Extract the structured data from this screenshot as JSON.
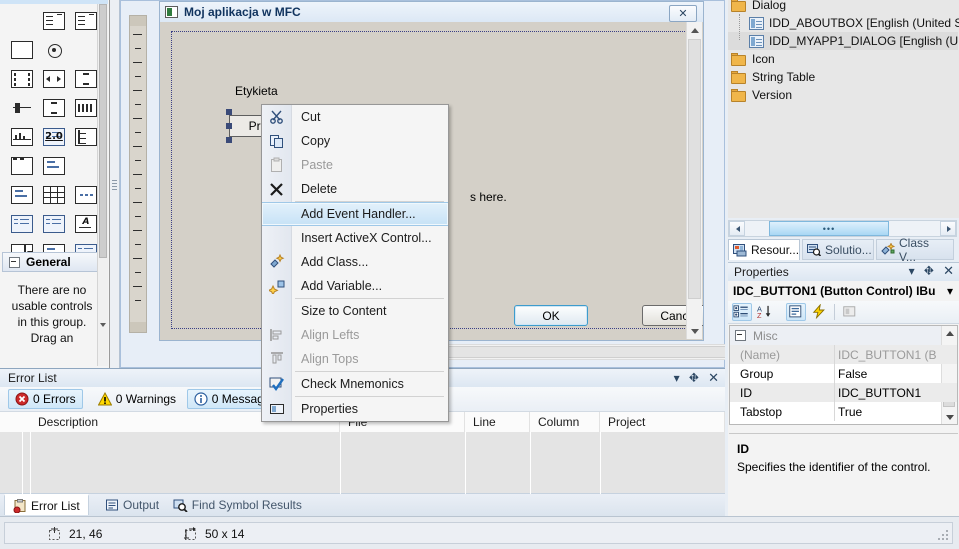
{
  "toolbox": {
    "group_label": "General",
    "empty_text": "There are no usable controls in this group. Drag an",
    "icons": [
      "textbox-icon",
      "listbox-icon",
      "listcontrol-icon",
      "groupbox-icon",
      "radio-button-icon",
      "static-text-icon",
      "animation-icon",
      "splitbutton-icon",
      "spin-control-icon",
      "slider-icon",
      "scrollbar-icon",
      "progress-icon",
      "hotkey-icon",
      "listview-icon",
      "treecontrol-icon",
      "picture-icon",
      "mfc-control-icon",
      "link-control-icon",
      "syslink-icon",
      "grid-control-icon",
      "ellipsis-icon",
      "tab-control-icon",
      "custom-control-icon",
      "rich-edit-icon",
      "combobox-icon",
      "network-icon",
      "caption-icon"
    ]
  },
  "designer": {
    "dialog_title": "Moj aplikacja w MFC",
    "close_button": "✕",
    "label_etykieta": "Etykieta",
    "button_przycisk": "Przycisk",
    "radio_dot": "∘",
    "static_here": "s here.",
    "ok_label": "OK",
    "cancel_label": "Cancel"
  },
  "context_menu": {
    "items": [
      {
        "label": "Cut",
        "icon": "scissors-icon",
        "enabled": true,
        "selected": false,
        "sep_after": false
      },
      {
        "label": "Copy",
        "icon": "copy-icon",
        "enabled": true,
        "selected": false,
        "sep_after": false
      },
      {
        "label": "Paste",
        "icon": "paste-icon",
        "enabled": false,
        "selected": false,
        "sep_after": false
      },
      {
        "label": "Delete",
        "icon": "delete-x-icon",
        "enabled": true,
        "selected": false,
        "sep_after": true
      },
      {
        "label": "Add Event Handler...",
        "icon": "",
        "enabled": true,
        "selected": true,
        "sep_after": false
      },
      {
        "label": "Insert ActiveX Control...",
        "icon": "",
        "enabled": true,
        "selected": false,
        "sep_after": false
      },
      {
        "label": "Add Class...",
        "icon": "add-class-icon",
        "enabled": true,
        "selected": false,
        "sep_after": false
      },
      {
        "label": "Add Variable...",
        "icon": "add-variable-icon",
        "enabled": true,
        "selected": false,
        "sep_after": true
      },
      {
        "label": "Size to Content",
        "icon": "",
        "enabled": true,
        "selected": false,
        "sep_after": false
      },
      {
        "label": "Align Lefts",
        "icon": "align-lefts-icon",
        "enabled": false,
        "selected": false,
        "sep_after": false
      },
      {
        "label": "Align Tops",
        "icon": "align-tops-icon",
        "enabled": false,
        "selected": false,
        "sep_after": true
      },
      {
        "label": "Check Mnemonics",
        "icon": "check-mnemonics-icon",
        "enabled": true,
        "selected": false,
        "sep_after": true
      },
      {
        "label": "Properties",
        "icon": "properties-icon",
        "enabled": true,
        "selected": false,
        "sep_after": false
      }
    ]
  },
  "error_list": {
    "title": "Error List",
    "filters": [
      {
        "label": "0 Errors",
        "icon": "error-icon",
        "active": true
      },
      {
        "label": "0 Warnings",
        "icon": "warning-icon",
        "active": false
      },
      {
        "label": "0 Messages",
        "icon": "info-icon",
        "active": true
      }
    ],
    "columns": [
      "Description",
      "File",
      "Line",
      "Column",
      "Project"
    ],
    "rows": [],
    "tabs": [
      {
        "label": "Error List",
        "icon": "error-list-icon",
        "active": true
      },
      {
        "label": "Output",
        "icon": "output-icon",
        "active": false
      },
      {
        "label": "Find Symbol Results",
        "icon": "find-symbol-icon",
        "active": false
      }
    ],
    "window_actions": [
      "dropdown-icon",
      "pin-icon",
      "close-icon"
    ]
  },
  "resource_view": {
    "nodes": [
      {
        "label": "Dialog",
        "type": "folder",
        "indent": 0,
        "selected": false
      },
      {
        "label": "IDD_ABOUTBOX [English (United S",
        "type": "dialog",
        "indent": 1,
        "selected": false
      },
      {
        "label": "IDD_MYAPP1_DIALOG [English (U",
        "type": "dialog",
        "indent": 1,
        "selected": true
      },
      {
        "label": "Icon",
        "type": "folder",
        "indent": 0,
        "selected": false
      },
      {
        "label": "String Table",
        "type": "folder",
        "indent": 0,
        "selected": false
      },
      {
        "label": "Version",
        "type": "folder",
        "indent": 0,
        "selected": false
      }
    ],
    "scroll_thumb_glyph": "•••",
    "tabs": [
      {
        "label": "Resour...",
        "icon": "resource-view-icon",
        "active": true
      },
      {
        "label": "Solutio...",
        "icon": "solution-explorer-icon",
        "active": false
      },
      {
        "label": "Class V...",
        "icon": "class-view-icon",
        "active": false
      }
    ]
  },
  "properties": {
    "title": "Properties",
    "object": "IDC_BUTTON1 (Button Control) IBu",
    "object_dropdown": "▾",
    "window_actions": [
      "dropdown-icon",
      "pin-icon",
      "close-icon"
    ],
    "toolbar": [
      {
        "name": "categorized-icon",
        "active": true
      },
      {
        "name": "alphabetical-icon",
        "active": false
      },
      {
        "name": "properties-page-icon",
        "active": true
      },
      {
        "name": "events-icon",
        "active": false
      },
      {
        "name": "property-pages-icon",
        "active": false
      }
    ],
    "category": "Misc",
    "rows": [
      {
        "key": "(Name)",
        "value": "IDC_BUTTON1 (B",
        "grayed": true
      },
      {
        "key": "Group",
        "value": "False",
        "grayed": false
      },
      {
        "key": "ID",
        "value": "IDC_BUTTON1",
        "grayed": false
      },
      {
        "key": "Tabstop",
        "value": "True",
        "grayed": false
      }
    ],
    "description_title": "ID",
    "description_text": "Specifies the identifier of the control."
  },
  "status_bar": {
    "position": "21, 46",
    "size": "50 x 14",
    "position_icon": "crosshair-icon",
    "size_icon": "resize-icon"
  }
}
